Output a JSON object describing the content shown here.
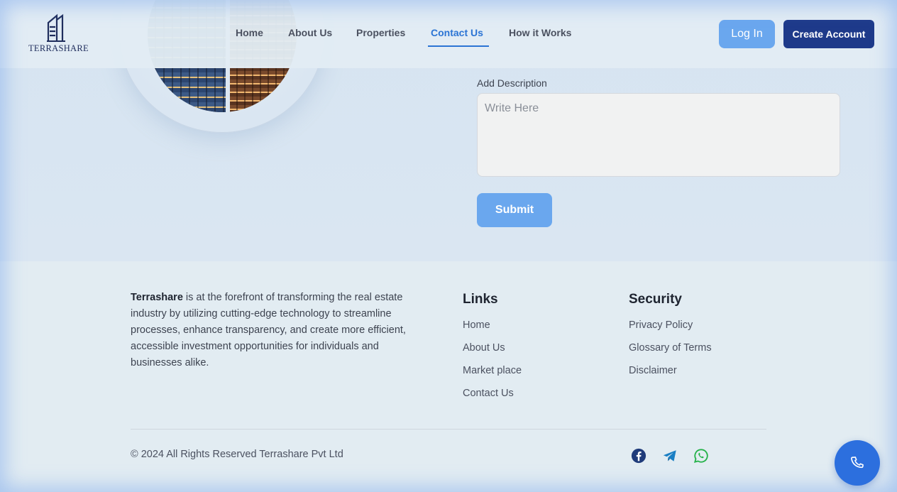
{
  "header": {
    "logo_text": "TERRASHARE",
    "nav": [
      {
        "label": "Home"
      },
      {
        "label": "About Us"
      },
      {
        "label": "Properties"
      },
      {
        "label": "Contact Us",
        "active": true
      },
      {
        "label": "How it Works"
      }
    ],
    "login_label": "Log In",
    "create_account_label": "Create Account"
  },
  "form": {
    "description_label": "Add Description",
    "description_placeholder": "Write Here",
    "description_value": "",
    "submit_label": "Submit"
  },
  "footer": {
    "about_brand": "Terrashare",
    "about_text": " is at the forefront of transforming the real estate industry by utilizing cutting-edge technology to streamline processes, enhance transparency, and create more efficient, accessible investment opportunities for individuals and businesses alike.",
    "links_title": "Links",
    "links": [
      "Home",
      "About Us",
      "Market place",
      "Contact Us"
    ],
    "security_title": "Security",
    "security_links": [
      "Privacy Policy",
      "Glossary of Terms",
      "Disclaimer"
    ],
    "copyright": "© 2024 All Rights Reserved Terrashare Pvt Ltd",
    "social_icons": [
      "facebook-icon",
      "telegram-icon",
      "whatsapp-icon"
    ]
  },
  "colors": {
    "primary": "#1e3a8a",
    "accent": "#6aa7ee",
    "active_nav": "#2b74d4",
    "fab": "#2c6fde",
    "facebook": "#1f3b7a",
    "telegram": "#1a7fc4",
    "whatsapp": "#25b24a"
  },
  "floating_action": {
    "icon": "phone-icon"
  }
}
